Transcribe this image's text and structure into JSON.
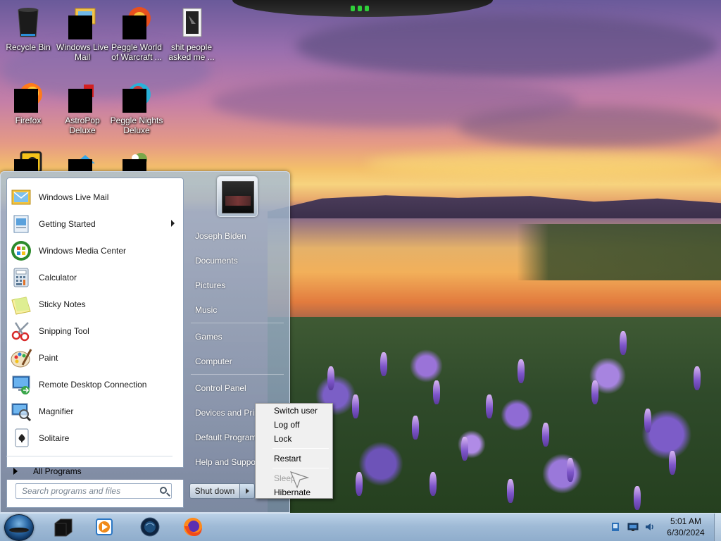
{
  "desktop": {
    "icons": [
      {
        "label": "Recycle Bin"
      },
      {
        "label": "Windows Live Mail"
      },
      {
        "label": "Peggle World of Warcraft ..."
      },
      {
        "label": "shit people asked me ..."
      },
      {
        "label": "Firefox"
      },
      {
        "label": "AstroPop Deluxe"
      },
      {
        "label": "Peggle Nights Deluxe"
      }
    ]
  },
  "start_menu": {
    "programs": [
      {
        "label": "Windows Live Mail",
        "icon": "mail-icon"
      },
      {
        "label": "Getting Started",
        "icon": "getting-started-icon"
      },
      {
        "label": "Windows Media Center",
        "icon": "media-center-icon"
      },
      {
        "label": "Calculator",
        "icon": "calculator-icon"
      },
      {
        "label": "Sticky Notes",
        "icon": "sticky-notes-icon"
      },
      {
        "label": "Snipping Tool",
        "icon": "snipping-tool-icon"
      },
      {
        "label": "Paint",
        "icon": "paint-icon"
      },
      {
        "label": "Remote Desktop Connection",
        "icon": "remote-desktop-icon"
      },
      {
        "label": "Magnifier",
        "icon": "magnifier-icon"
      },
      {
        "label": "Solitaire",
        "icon": "solitaire-icon"
      }
    ],
    "all_programs": "All Programs",
    "search_placeholder": "Search programs and files",
    "right_links": [
      {
        "label": "Joseph Biden"
      },
      {
        "label": "Documents"
      },
      {
        "label": "Pictures"
      },
      {
        "label": "Music"
      },
      {
        "label": "Games"
      },
      {
        "label": "Computer"
      },
      {
        "label": "Control Panel"
      },
      {
        "label": "Devices and Printers"
      },
      {
        "label": "Default Programs"
      },
      {
        "label": "Help and Support"
      }
    ],
    "shutdown_label": "Shut down"
  },
  "shutdown_menu": {
    "items": [
      {
        "label": "Switch user",
        "enabled": true
      },
      {
        "label": "Log off",
        "enabled": true
      },
      {
        "label": "Lock",
        "enabled": true
      },
      {
        "label": "Restart",
        "enabled": true
      },
      {
        "label": "Sleep",
        "enabled": false
      },
      {
        "label": "Hibernate",
        "enabled": true
      }
    ]
  },
  "taskbar": {
    "pinned": [
      {
        "icon": "black-app-icon"
      },
      {
        "icon": "media-player-icon"
      },
      {
        "icon": "world-globe-icon"
      },
      {
        "icon": "firefox-icon"
      }
    ],
    "clock": {
      "time": "5:01 AM",
      "date": "6/30/2024"
    }
  },
  "colors": {
    "taskbar": "#9fbad6",
    "start_menu_right": "#7f97b0",
    "flyout_bg": "#f0f0f0"
  }
}
